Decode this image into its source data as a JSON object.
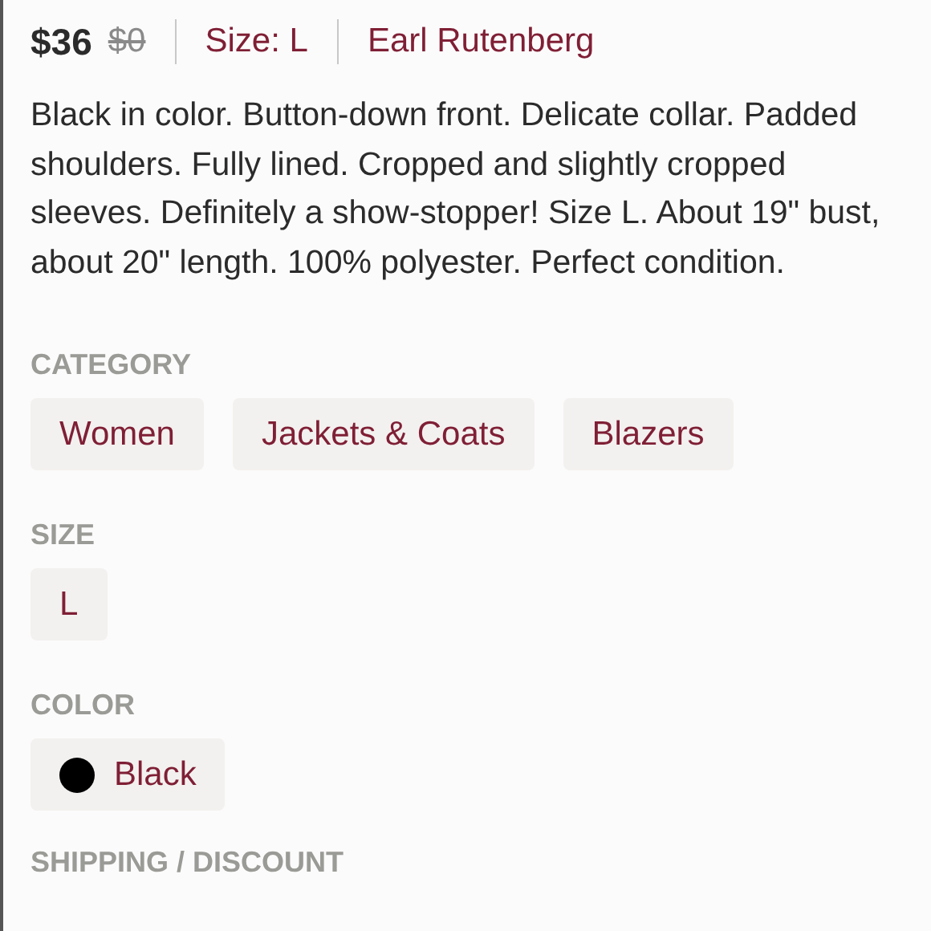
{
  "header": {
    "price": "$36",
    "original_price": "$0",
    "size": "Size: L",
    "brand": "Earl Rutenberg"
  },
  "description": "Black in color. Button-down front. Delicate collar. Padded shoulders. Fully lined. Cropped and slightly cropped sleeves. Definitely a show-stopper! Size L. About 19\" bust, about 20\" length. 100% polyester. Perfect condition.",
  "sections": [
    {
      "title": "CATEGORY",
      "kind": "tags",
      "tags": [
        {
          "label": "Women"
        },
        {
          "label": "Jackets & Coats"
        },
        {
          "label": "Blazers"
        }
      ]
    },
    {
      "title": "SIZE",
      "kind": "tags",
      "tags": [
        {
          "label": "L"
        }
      ]
    },
    {
      "title": "COLOR",
      "kind": "colors",
      "tags": [
        {
          "label": "Black",
          "color": "#000000"
        }
      ]
    }
  ],
  "next_section": "SHIPPING / DISCOUNT"
}
